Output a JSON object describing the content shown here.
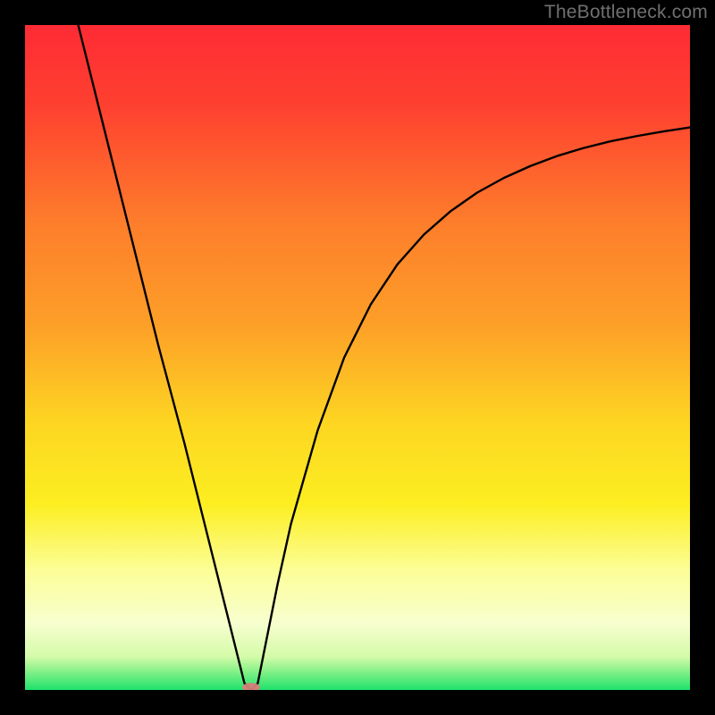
{
  "watermark": "TheBottleneck.com",
  "chart_data": {
    "type": "line",
    "title": "",
    "xlabel": "",
    "ylabel": "",
    "xlim": [
      0,
      100
    ],
    "ylim": [
      0,
      100
    ],
    "grid": false,
    "series": [
      {
        "name": "curve",
        "x": [
          8,
          12,
          16,
          20,
          24,
          28,
          30,
          32,
          33,
          34,
          35,
          36,
          38,
          40,
          44,
          48,
          52,
          56,
          60,
          64,
          68,
          72,
          76,
          80,
          84,
          88,
          92,
          96,
          100
        ],
        "y": [
          100,
          84,
          68,
          52,
          37,
          21,
          13,
          5,
          1,
          0,
          1,
          6,
          16,
          25,
          39,
          50,
          58,
          64,
          68.5,
          72,
          74.8,
          77,
          78.8,
          80.3,
          81.5,
          82.5,
          83.3,
          84,
          84.6
        ]
      }
    ],
    "curve_min_x": 34,
    "marker": {
      "x": 34,
      "y": 0,
      "color": "#d68079"
    },
    "background_gradient": {
      "top": "#fe2b34",
      "mid_upper": "#fd9f28",
      "mid": "#fcee21",
      "mid_lower": "#fcfe97",
      "lower_band": "#f7fecf",
      "bottom": "#1ee26c"
    }
  }
}
